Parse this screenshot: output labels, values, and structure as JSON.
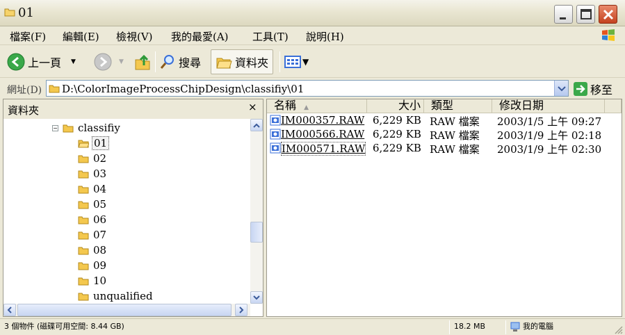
{
  "window": {
    "title": "01"
  },
  "menu": {
    "items": [
      "檔案(F)",
      "編輯(E)",
      "檢視(V)",
      "我的最愛(A)",
      "工具(T)",
      "說明(H)"
    ]
  },
  "toolbar": {
    "back_label": "上一頁",
    "search_label": "搜尋",
    "folders_label": "資料夾"
  },
  "address": {
    "label": "網址(D)",
    "value": "D:\\ColorImageProcessChipDesign\\classifiy\\01",
    "go_label": "移至"
  },
  "folder_pane": {
    "title": "資料夾",
    "close_glyph": "×",
    "parent": "classifiy",
    "children": [
      "01",
      "02",
      "03",
      "04",
      "05",
      "06",
      "07",
      "08",
      "09",
      "10",
      "unqualified"
    ],
    "selected": "01"
  },
  "file_list": {
    "columns": {
      "name": "名稱",
      "size": "大小",
      "type": "類型",
      "modified": "修改日期"
    },
    "files": [
      {
        "name": "IM000357.RAW",
        "size": "6,229 KB",
        "type": "RAW 檔案",
        "modified": "2003/1/5 上午 09:27"
      },
      {
        "name": "IM000566.RAW",
        "size": "6,229 KB",
        "type": "RAW 檔案",
        "modified": "2003/1/9 上午 02:18"
      },
      {
        "name": "IM000571.RAW",
        "size": "6,229 KB",
        "type": "RAW 檔案",
        "modified": "2003/1/9 上午 02:30"
      }
    ]
  },
  "status": {
    "objects": "3 個物件 (磁碟可用空間: 8.44 GB)",
    "size": "18.2 MB",
    "location": "我的電腦"
  },
  "colors": {
    "accent": "#3A6FD8",
    "selection": "#316AC5",
    "close": "#C4421F"
  }
}
